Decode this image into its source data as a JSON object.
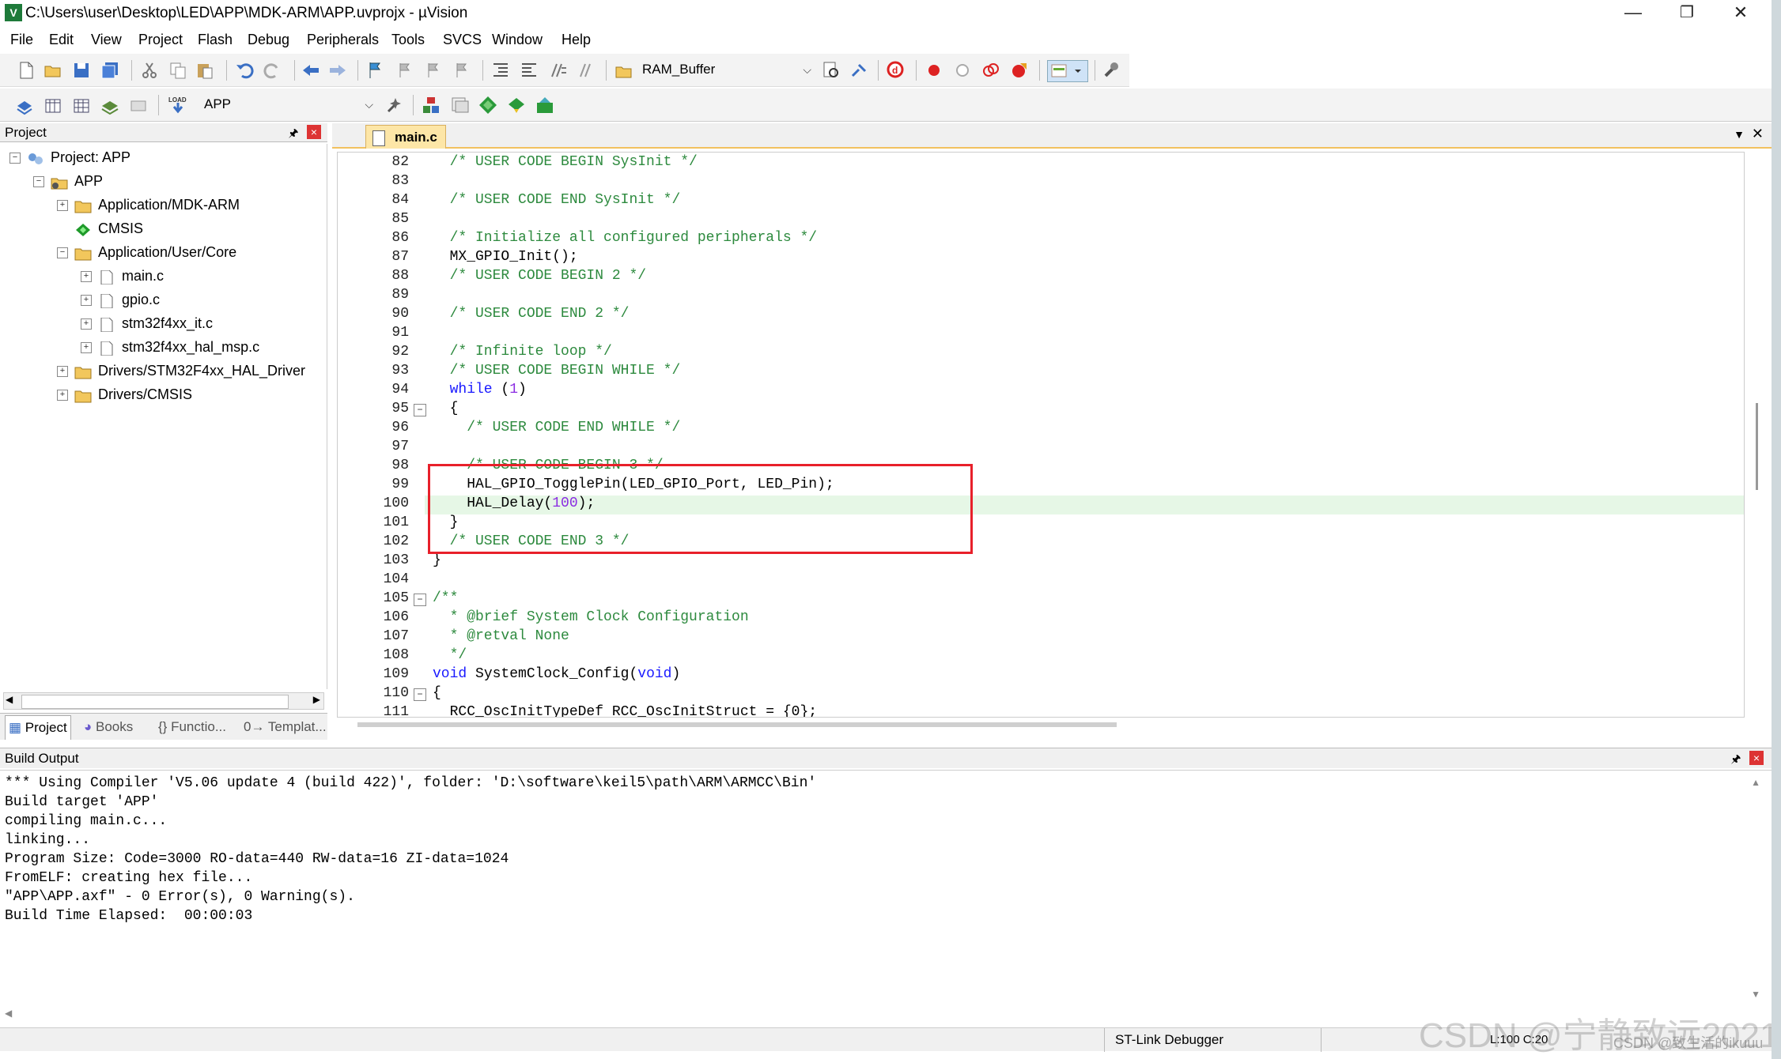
{
  "window": {
    "title": "C:\\Users\\user\\Desktop\\LED\\APP\\MDK-ARM\\APP.uvprojx - µVision",
    "minimize": "—",
    "restore": "❐",
    "close": "✕"
  },
  "menu": [
    "File",
    "Edit",
    "View",
    "Project",
    "Flash",
    "Debug",
    "Peripherals",
    "Tools",
    "SVCS",
    "Window",
    "Help"
  ],
  "toolbar": {
    "target_combo": "RAM_Buffer",
    "project_combo": "APP"
  },
  "project_panel": {
    "title": "Project",
    "pin": "🖈",
    "close": "×",
    "tree": [
      {
        "label": "Project: APP",
        "expander": "−"
      },
      {
        "label": "APP",
        "expander": "−"
      },
      {
        "label": "Application/MDK-ARM",
        "expander": "+"
      },
      {
        "label": "CMSIS",
        "expander": ""
      },
      {
        "label": "Application/User/Core",
        "expander": "−"
      },
      {
        "label": "main.c",
        "expander": "+"
      },
      {
        "label": "gpio.c",
        "expander": "+"
      },
      {
        "label": "stm32f4xx_it.c",
        "expander": "+"
      },
      {
        "label": "stm32f4xx_hal_msp.c",
        "expander": "+"
      },
      {
        "label": "Drivers/STM32F4xx_HAL_Driver",
        "expander": "+"
      },
      {
        "label": "Drivers/CMSIS",
        "expander": "+"
      }
    ],
    "tabs": [
      "Project",
      "Books",
      "{} Functio...",
      "0→ Templat..."
    ]
  },
  "editor": {
    "tab": "main.c",
    "lines": [
      {
        "n": "82",
        "fold": "",
        "parts": [
          {
            "t": "  /* USER CODE BEGIN SysInit */",
            "c": "cmt"
          }
        ]
      },
      {
        "n": "83",
        "fold": "",
        "parts": []
      },
      {
        "n": "84",
        "fold": "",
        "parts": [
          {
            "t": "  /* USER CODE END SysInit */",
            "c": "cmt"
          }
        ]
      },
      {
        "n": "85",
        "fold": "",
        "parts": []
      },
      {
        "n": "86",
        "fold": "",
        "parts": [
          {
            "t": "  /* Initialize all configured peripherals */",
            "c": "cmt"
          }
        ]
      },
      {
        "n": "87",
        "fold": "",
        "parts": [
          {
            "t": "  MX_GPIO_Init();",
            "c": ""
          }
        ]
      },
      {
        "n": "88",
        "fold": "",
        "parts": [
          {
            "t": "  /* USER CODE BEGIN 2 */",
            "c": "cmt"
          }
        ]
      },
      {
        "n": "89",
        "fold": "",
        "parts": []
      },
      {
        "n": "90",
        "fold": "",
        "parts": [
          {
            "t": "  /* USER CODE END 2 */",
            "c": "cmt"
          }
        ]
      },
      {
        "n": "91",
        "fold": "",
        "parts": []
      },
      {
        "n": "92",
        "fold": "",
        "parts": [
          {
            "t": "  /* Infinite loop */",
            "c": "cmt"
          }
        ]
      },
      {
        "n": "93",
        "fold": "",
        "parts": [
          {
            "t": "  /* USER CODE BEGIN WHILE */",
            "c": "cmt"
          }
        ]
      },
      {
        "n": "94",
        "fold": "",
        "parts": [
          {
            "t": "  while",
            "c": "kw"
          },
          {
            "t": " (",
            "c": ""
          },
          {
            "t": "1",
            "c": "num"
          },
          {
            "t": ")",
            "c": ""
          }
        ]
      },
      {
        "n": "95",
        "fold": "−",
        "parts": [
          {
            "t": "  {",
            "c": ""
          }
        ]
      },
      {
        "n": "96",
        "fold": "",
        "parts": [
          {
            "t": "    /* USER CODE END WHILE */",
            "c": "cmt"
          }
        ]
      },
      {
        "n": "97",
        "fold": "",
        "parts": []
      },
      {
        "n": "98",
        "fold": "",
        "parts": [
          {
            "t": "    /* USER CODE BEGIN 3 */",
            "c": "cmt"
          }
        ]
      },
      {
        "n": "99",
        "fold": "",
        "parts": [
          {
            "t": "    HAL_GPIO_TogglePin(LED_GPIO_Port, LED_Pin);",
            "c": ""
          }
        ]
      },
      {
        "n": "100",
        "fold": "",
        "parts": [
          {
            "t": "    HAL_Delay(",
            "c": ""
          },
          {
            "t": "100",
            "c": "num"
          },
          {
            "t": ");",
            "c": ""
          }
        ]
      },
      {
        "n": "101",
        "fold": "",
        "parts": [
          {
            "t": "  }",
            "c": ""
          }
        ]
      },
      {
        "n": "102",
        "fold": "",
        "parts": [
          {
            "t": "  /* USER CODE END 3 */",
            "c": "cmt"
          }
        ]
      },
      {
        "n": "103",
        "fold": "",
        "parts": [
          {
            "t": "}",
            "c": ""
          }
        ]
      },
      {
        "n": "104",
        "fold": "",
        "parts": []
      },
      {
        "n": "105",
        "fold": "−",
        "parts": [
          {
            "t": "/**",
            "c": "cmt"
          }
        ]
      },
      {
        "n": "106",
        "fold": "",
        "parts": [
          {
            "t": "  * @brief System Clock Configuration",
            "c": "cmt"
          }
        ]
      },
      {
        "n": "107",
        "fold": "",
        "parts": [
          {
            "t": "  * @retval None",
            "c": "cmt"
          }
        ]
      },
      {
        "n": "108",
        "fold": "",
        "parts": [
          {
            "t": "  */",
            "c": "cmt"
          }
        ]
      },
      {
        "n": "109",
        "fold": "",
        "parts": [
          {
            "t": "void",
            "c": "kw"
          },
          {
            "t": " SystemClock_Config(",
            "c": ""
          },
          {
            "t": "void",
            "c": "kw"
          },
          {
            "t": ")",
            "c": ""
          }
        ]
      },
      {
        "n": "110",
        "fold": "−",
        "parts": [
          {
            "t": "{",
            "c": ""
          }
        ]
      },
      {
        "n": "111",
        "fold": "",
        "parts": [
          {
            "t": "  RCC_OscInitTypeDef RCC_OscInitStruct = {0};",
            "c": ""
          }
        ]
      }
    ]
  },
  "build_output": {
    "title": "Build Output",
    "pin": "🖈",
    "close": "×",
    "lines": [
      "*** Using Compiler 'V5.06 update 4 (build 422)', folder: 'D:\\software\\keil5\\path\\ARM\\ARMCC\\Bin'",
      "Build target 'APP'",
      "compiling main.c...",
      "linking...",
      "Program Size: Code=3000 RO-data=440 RW-data=16 ZI-data=1024",
      "FromELF: creating hex file...",
      "\"APP\\APP.axf\" - 0 Error(s), 0 Warning(s).",
      "Build Time Elapsed:  00:00:03"
    ]
  },
  "status": {
    "debugger": "ST-Link Debugger",
    "position": "L:100 C:20"
  },
  "watermark": {
    "main": "CSDN @宁静致远2021",
    "sub": "CSDN @致生活的ikuuu"
  },
  "colors": {
    "comment": "#2d8a3e",
    "keyword": "#1a1aff",
    "number": "#8a2be2",
    "highlight_box": "#e8202a",
    "tab_active": "#fde6a7"
  }
}
